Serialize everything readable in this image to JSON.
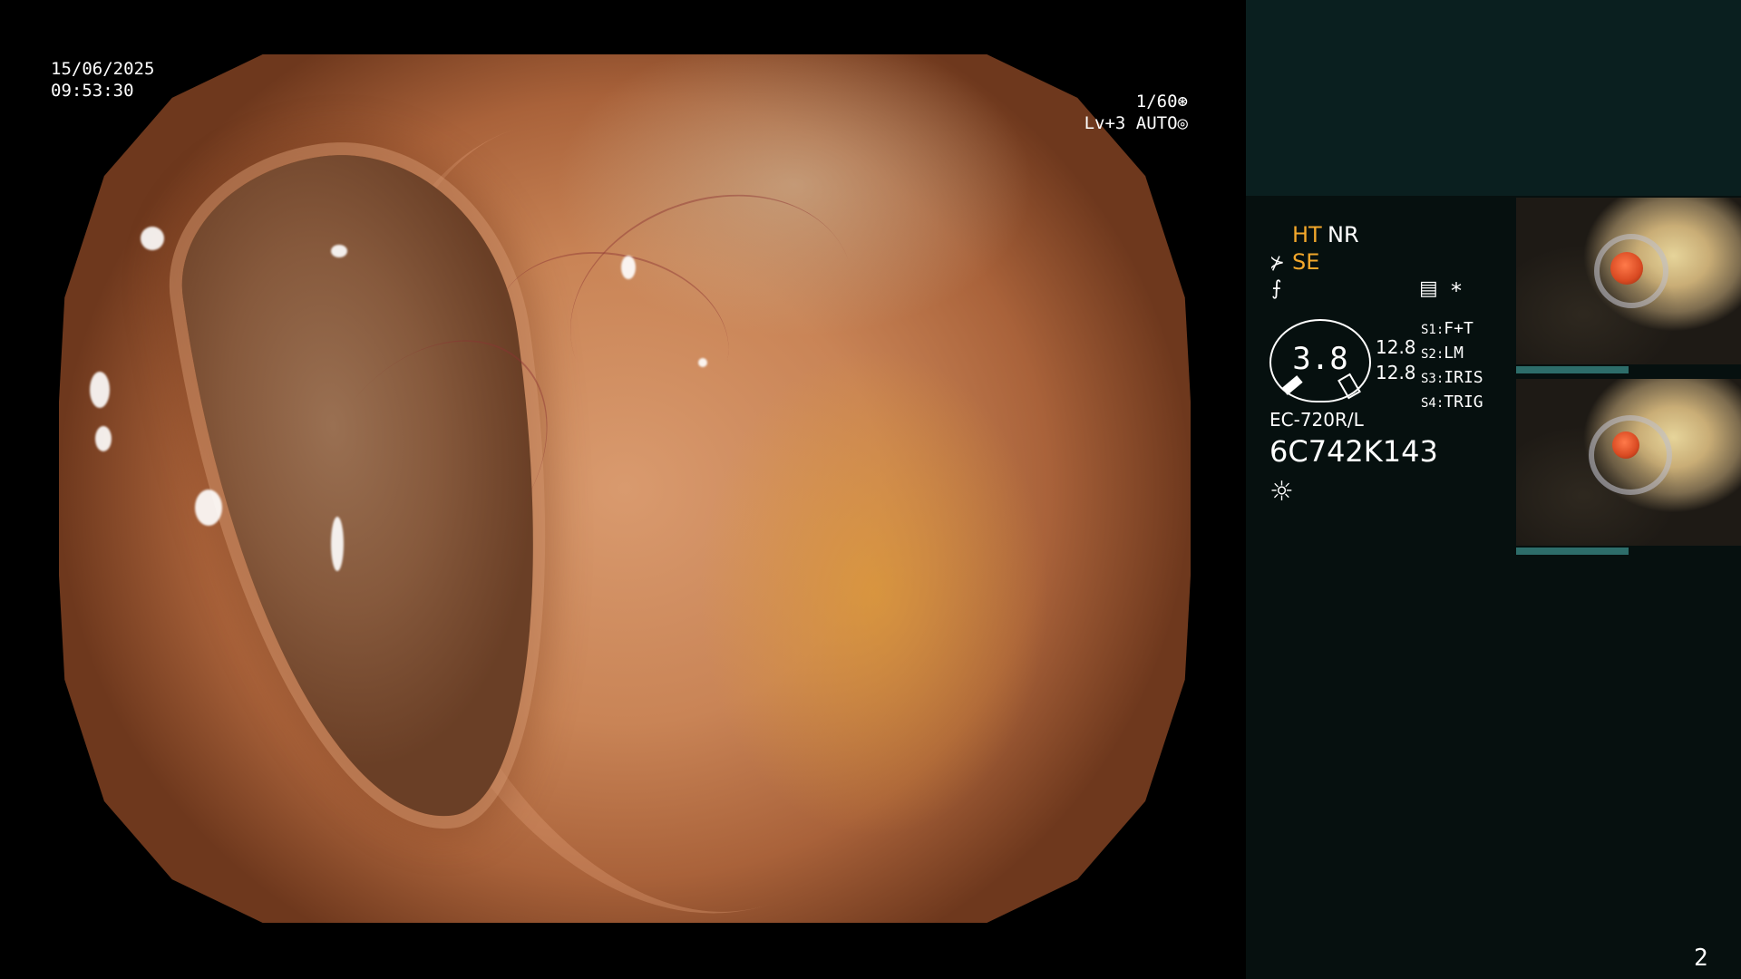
{
  "video": {
    "date": "15/06/2025",
    "time": "09:53:30",
    "shutter": "1/60⊛",
    "exposure": "Lv+3 AUTO◎"
  },
  "panel": {
    "ht": "HT",
    "nr": "NR",
    "se": "SE",
    "se_icon": "⊁",
    "f_icon": "⨍",
    "doc_icon": "▤",
    "star": "*",
    "gauge_value": "3.8",
    "readout1": "12.8",
    "readout2": "12.8",
    "scope_label": "EC-720R/L",
    "serial": "6C742K143",
    "light_icon": "☼",
    "switches": [
      {
        "key": "S1:",
        "value": "F+T"
      },
      {
        "key": "S2:",
        "value": "LM"
      },
      {
        "key": "S3:",
        "value": "IRIS"
      },
      {
        "key": "S4:",
        "value": "TRIG"
      }
    ],
    "page_number": "2"
  },
  "colors": {
    "accent_orange": "#f3a72b",
    "panel_bg": "#06100f",
    "panel_top": "#0a1f1f",
    "thumb_bar": "#2d6d6a"
  },
  "icons": {
    "shutter": "aperture-icon",
    "exposure": "iris-icon",
    "light": "sun-icon"
  }
}
